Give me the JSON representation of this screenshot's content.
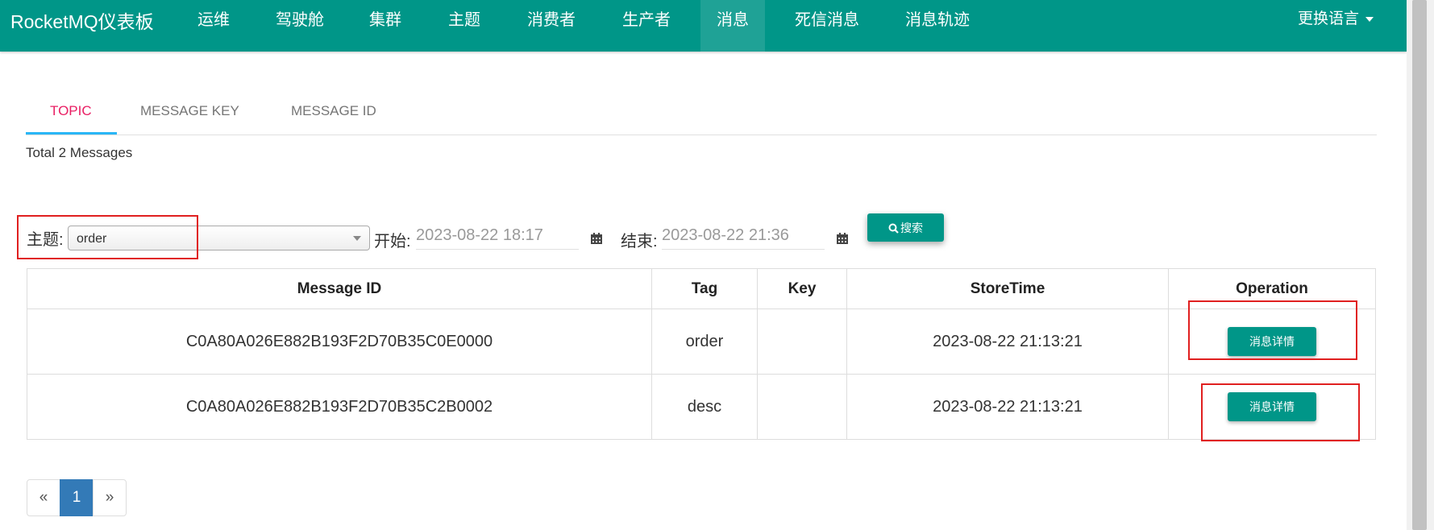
{
  "navbar": {
    "brand": "RocketMQ仪表板",
    "items": [
      "运维",
      "驾驶舱",
      "集群",
      "主题",
      "消费者",
      "生产者",
      "消息",
      "死信消息",
      "消息轨迹"
    ],
    "active_item": "消息",
    "language": "更换语言",
    "color": "#009688"
  },
  "tabs": [
    {
      "label": "TOPIC",
      "active": true
    },
    {
      "label": "MESSAGE KEY",
      "active": false
    },
    {
      "label": "MESSAGE ID",
      "active": false
    }
  ],
  "summary": {
    "total": "Total 2 Messages"
  },
  "filter": {
    "topic_label": "主题:",
    "topic_value": "order",
    "start_label": "开始:",
    "start_value": "2023-08-22 18:17",
    "end_label": "结束:",
    "end_value": "2023-08-22 21:36",
    "search_label": "搜索"
  },
  "table": {
    "headers": [
      "Message ID",
      "Tag",
      "Key",
      "StoreTime",
      "Operation"
    ],
    "rows": [
      {
        "message_id": "C0A80A026E882B193F2D70B35C0E0000",
        "tag": "order",
        "key": "",
        "store_time": "2023-08-22 21:13:21",
        "operation": "消息详情"
      },
      {
        "message_id": "C0A80A026E882B193F2D70B35C2B0002",
        "tag": "desc",
        "key": "",
        "store_time": "2023-08-22 21:13:21",
        "operation": "消息详情"
      }
    ]
  },
  "pagination": {
    "prev": "«",
    "current": "1",
    "next": "»"
  },
  "colors": {
    "accent": "#009688",
    "active_tab": "#e91e63",
    "tab_underline": "#29b6f6",
    "page_active": "#337ab7",
    "highlight_box": "#e02020"
  }
}
